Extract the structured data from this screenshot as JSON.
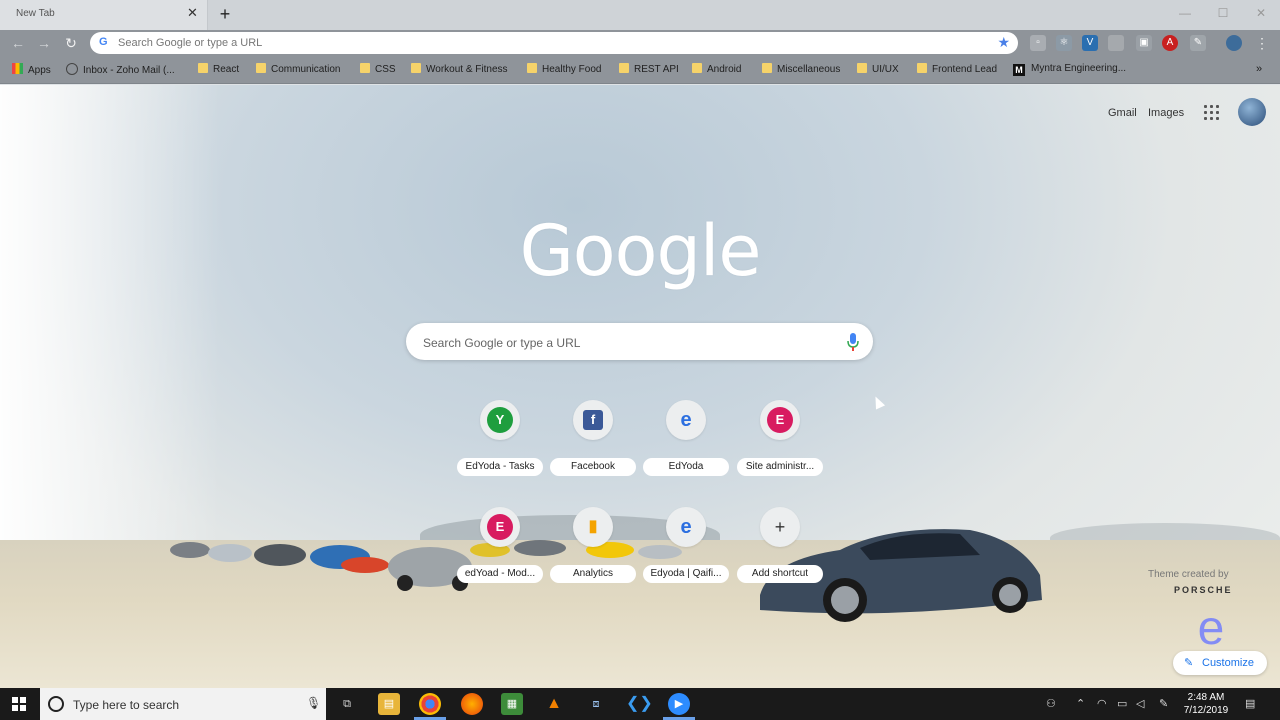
{
  "tab": {
    "title": "New Tab"
  },
  "toolbar": {
    "omnibox_placeholder": "Search Google or type a URL"
  },
  "bookmarks": [
    {
      "label": "Apps",
      "icon": "apps-icon"
    },
    {
      "label": "Inbox - Zoho Mail (...",
      "icon": "mail-icon"
    },
    {
      "label": "React",
      "icon": "folder-icon"
    },
    {
      "label": "Communication",
      "icon": "folder-icon"
    },
    {
      "label": "CSS",
      "icon": "folder-icon"
    },
    {
      "label": "Workout & Fitness",
      "icon": "folder-icon"
    },
    {
      "label": "Healthy Food",
      "icon": "folder-icon"
    },
    {
      "label": "REST API",
      "icon": "folder-icon"
    },
    {
      "label": "Android",
      "icon": "folder-icon"
    },
    {
      "label": "Miscellaneous",
      "icon": "folder-icon"
    },
    {
      "label": "UI/UX",
      "icon": "folder-icon"
    },
    {
      "label": "Frontend Lead",
      "icon": "folder-icon"
    },
    {
      "label": "Myntra Engineering...",
      "icon": "medium-icon"
    }
  ],
  "header": {
    "gmail": "Gmail",
    "images": "Images"
  },
  "logo": "Google",
  "search": {
    "placeholder": "Search Google or type a URL"
  },
  "shortcuts": [
    {
      "label": "EdYoda - Tasks",
      "glyph": "Y",
      "color": "#1e9e3e"
    },
    {
      "label": "Facebook",
      "glyph": "f",
      "color": "#3b5998"
    },
    {
      "label": "EdYoda",
      "glyph": "e",
      "color": "#2c6fe0"
    },
    {
      "label": "Site administr...",
      "glyph": "E",
      "color": "#d81b60"
    },
    {
      "label": "edYoad - Mod...",
      "glyph": "E",
      "color": "#d81b60"
    },
    {
      "label": "Analytics",
      "glyph": "▮",
      "color": "#f4a300"
    },
    {
      "label": "Edyoda | Qaifi...",
      "glyph": "e",
      "color": "#2c6fe0"
    },
    {
      "label": "Add shortcut",
      "glyph": "+",
      "color": "#333333"
    }
  ],
  "theme": {
    "credit": "Theme created by",
    "brand": "PORSCHE"
  },
  "customize": {
    "label": "Customize"
  },
  "taskbar": {
    "search_placeholder": "Type here to search",
    "time": "2:48 AM",
    "date": "7/12/2019"
  }
}
